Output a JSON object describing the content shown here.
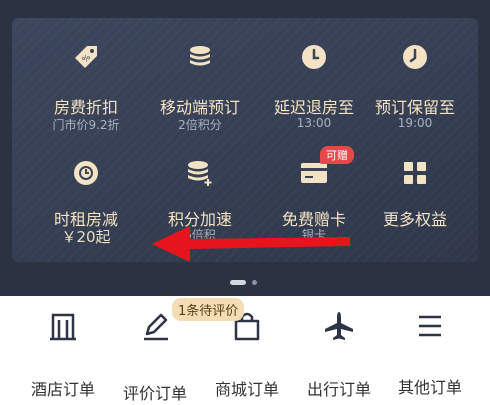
{
  "benefits": [
    {
      "title": "房费折扣",
      "subtitle": "门市价9.2折",
      "icon": "discount-tag-icon"
    },
    {
      "title": "移动端预订",
      "subtitle": "2倍积分",
      "icon": "coins-icon"
    },
    {
      "title": "延迟退房至",
      "subtitle": "13:00",
      "icon": "clock-icon"
    },
    {
      "title": "预订保留至",
      "subtitle": "19:00",
      "icon": "clock-icon"
    },
    {
      "title": "时租房减",
      "subtitle": "￥20起",
      "icon": "timer-icon"
    },
    {
      "title": "积分加速",
      "subtitle": "6倍积",
      "icon": "coins-plus-icon"
    },
    {
      "title": "免费赠卡",
      "subtitle": "银卡",
      "icon": "card-icon",
      "badge": "可赠"
    },
    {
      "title": "更多权益",
      "subtitle": "",
      "icon": "grid-icon"
    }
  ],
  "carousel": {
    "pages": 2,
    "active": 1
  },
  "pending_badge": "1条待评价",
  "orders": [
    {
      "label": "酒店订单",
      "icon": "hotel-icon"
    },
    {
      "label": "评价订单",
      "icon": "pen-icon"
    },
    {
      "label": "商城订单",
      "icon": "shopping-bag-icon"
    },
    {
      "label": "出行订单",
      "icon": "airplane-icon"
    },
    {
      "label": "其他订单",
      "icon": "list-icon"
    }
  ],
  "colors": {
    "card_bg": "#353e52",
    "gold_text": "#f3e2c4",
    "badge_red": "#e8474a",
    "arrow_red": "#e8141c"
  }
}
